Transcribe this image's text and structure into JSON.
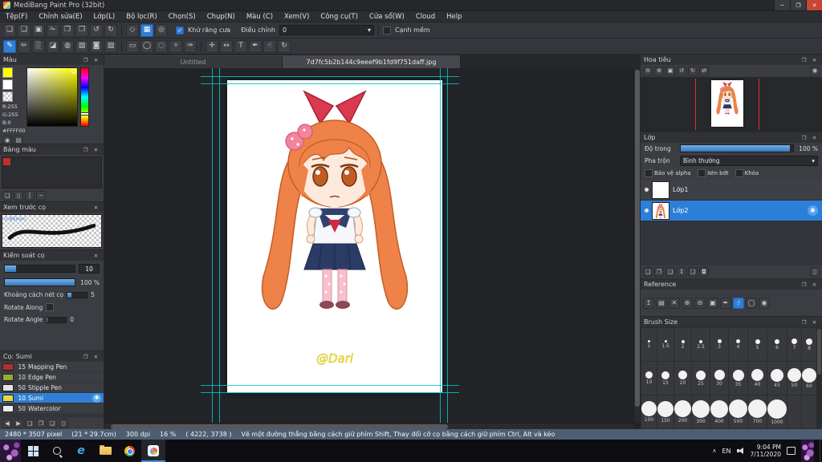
{
  "window": {
    "title": "MediBang Paint Pro (32bit)"
  },
  "menubar": {
    "items": [
      "Tệp(F)",
      "Chỉnh sửa(E)",
      "Lớp(L)",
      "Bộ lọc(R)",
      "Chọn(S)",
      "Chụp(N)",
      "Màu (C)",
      "Xem(V)",
      "Công cụ(T)",
      "Cửa sổ(W)",
      "Cloud",
      "Help"
    ]
  },
  "toolbar": {
    "antialias_label": "Khử răng cưa",
    "adjust_label": "Điều chỉnh",
    "adjust_value": "0",
    "soft_edge_label": "Cạnh mềm"
  },
  "tabs": {
    "items": [
      {
        "label": "Untitled"
      },
      {
        "label": "7d7fc5b2b144c9eeef9b1fd9f751daff.jpg"
      }
    ]
  },
  "panels": {
    "color": "Màu",
    "palette": "Bảng màu",
    "preview": "Xem trước cọ",
    "control": "Kiểm soát cọ",
    "brush": "Cọ: Sumi",
    "navigator": "Hoa tiêu",
    "layer": "Lớp",
    "reference": "Reference",
    "brush_size": "Brush Size"
  },
  "color_panel": {
    "r": "R:255",
    "g": "G:255",
    "b": "B:0",
    "hex": "#FFFF00",
    "selected_color": "#ffff00"
  },
  "brush_preview": {
    "size_label": "0.85mm"
  },
  "brush_control": {
    "size_value": "10",
    "opacity_value": "100 %",
    "spacing_label": "Khoảng cách nét cọ",
    "spacing_value": "5",
    "rotate_along_label": "Rotate Along",
    "rotate_angle_label": "Rotate Angle",
    "rotate_angle_value": "0"
  },
  "brushes": {
    "items": [
      {
        "size": "15",
        "name": "Mapping Pen",
        "color": "#b03030"
      },
      {
        "size": "10",
        "name": "Edge Pen",
        "color": "#9aa832"
      },
      {
        "size": "50",
        "name": "Stipple Pen",
        "color": "#e2e2e2"
      },
      {
        "size": "10",
        "name": "Sumi",
        "color": "#e8d840"
      },
      {
        "size": "50",
        "name": "Watercolor",
        "color": "#ececec"
      }
    ]
  },
  "layer_panel": {
    "opacity_label": "Độ trong",
    "opacity_value": "100 %",
    "blend_label": "Pha trộn",
    "blend_value": "Bình thường",
    "protect_alpha_label": "Bảo vệ alpha",
    "clipping_label": "Xén bớt",
    "lock_label": "Khóa",
    "layers": [
      {
        "name": "Lớp1"
      },
      {
        "name": "Lớp2"
      }
    ]
  },
  "brush_size_panel": {
    "sizes": [
      "1",
      "1.5",
      "2",
      "2.5",
      "3",
      "4",
      "5",
      "6",
      "7",
      "8",
      "10",
      "15",
      "20",
      "25",
      "30",
      "35",
      "40",
      "45",
      "50",
      "60",
      "100",
      "150",
      "200",
      "300",
      "400",
      "500",
      "700",
      "1000"
    ]
  },
  "canvas": {
    "signature": "@Dari"
  },
  "statusbar": {
    "dimensions": "2480 * 3507 pixel",
    "print_size": "(21 * 29.7cm)",
    "dpi": "300 dpi",
    "zoom": "16 %",
    "coords": "( 4222, 3738 )",
    "hint": "Vẽ một đường thẳng bằng cách giữ phím Shift, Thay đổi cỡ cọ bằng cách giữ phím Ctrl, Alt và kéo"
  },
  "taskbar": {
    "language": "EN",
    "time": "9:04 PM",
    "date": "7/11/2020"
  },
  "colors": {
    "accent": "#2f7fd6",
    "selected_layer": "#2b7fd9",
    "guide": "#00c6c6",
    "palette_swatch": "#c03028",
    "signature": "#f0e44c"
  },
  "icons": {
    "minimize": "─",
    "maximize": "❐",
    "close": "✕",
    "panel_float": "❐",
    "panel_close": "✕",
    "new_page": "❑",
    "open": "❏",
    "save": "▣",
    "cut": "✁",
    "copy": "❐",
    "paste": "❒",
    "undo": "↺",
    "redo": "↻",
    "snap_off": "◇",
    "snap_grid": "▦",
    "snap_circle": "◎",
    "pen": "✎",
    "pencil": "✏",
    "airbrush": "░",
    "eraser": "◪",
    "blur": "◍",
    "fill": "▨",
    "bucket": "◙",
    "gradient": "▧",
    "select_rect": "▭",
    "select_ellipse": "◯",
    "lasso": "◌",
    "wand": "✧",
    "select_pen": "✑",
    "move": "✛",
    "transform": "↔",
    "text": "T",
    "eyedropper": "✒",
    "hand": "☝",
    "dropdown": "▾",
    "check": "✓",
    "gear": "✱",
    "eye": "●",
    "trash": "▯",
    "folder": "❏",
    "folder_add": "❑",
    "merge": "↧",
    "camera": "◘",
    "zoom_in": "⊕",
    "zoom_out": "⊖",
    "actual_size": "▣",
    "rotate_left": "↺",
    "rotate_right": "↻",
    "flip": "⇄",
    "arrow_up": "↥",
    "arrow_left": "◀",
    "arrow_right": "▶",
    "target": "◉",
    "palette": "▤",
    "line_v": "│",
    "line_h": "─"
  }
}
